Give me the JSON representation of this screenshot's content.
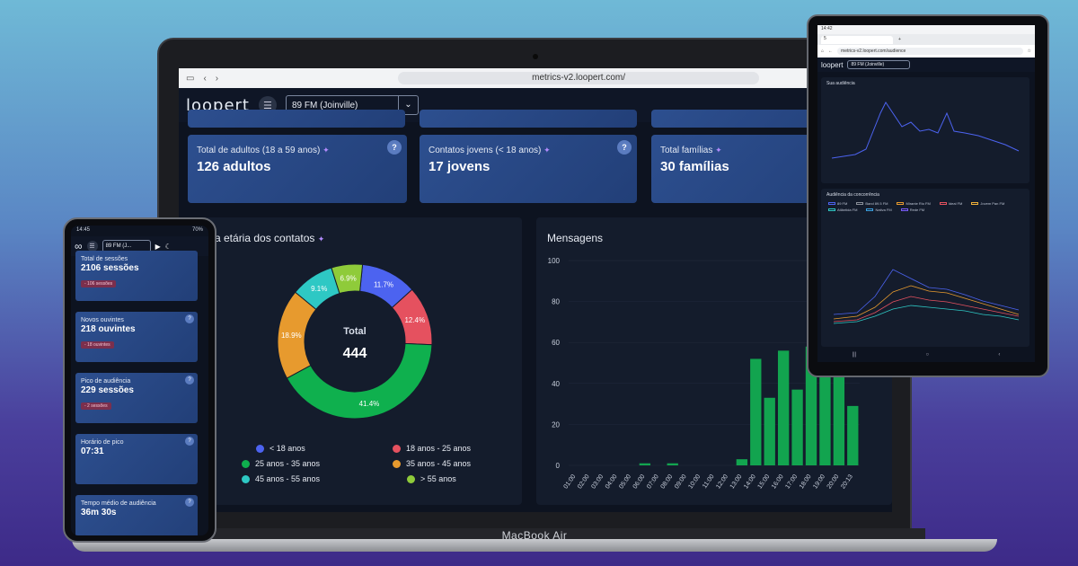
{
  "browser": {
    "url": "metrics-v2.loopert.com/"
  },
  "app": {
    "logo": "loopert",
    "station": "89 FM (Joinville)"
  },
  "cards": [
    {
      "label": "Total de adultos (18 a 59 anos)",
      "value": "126 adultos"
    },
    {
      "label": "Contatos jovens (< 18 anos)",
      "value": "17 jovens"
    },
    {
      "label": "Total famílias",
      "value": "30 famílias"
    }
  ],
  "age_panel": {
    "title": "a etária dos contatos",
    "total_label": "Total",
    "total_value": "444"
  },
  "messages_panel": {
    "title": "Mensagens"
  },
  "device": {
    "label": "MacBook Air"
  },
  "icons": {
    "sparkle": "✦",
    "help": "?",
    "volume": "🔈",
    "menu": "☰",
    "chevron": "⌄"
  },
  "chart_data": [
    {
      "type": "pie",
      "title": "",
      "categories": [
        "< 18 anos",
        "18 anos - 25 anos",
        "25 anos - 35 anos",
        "35 anos - 45 anos",
        "45 anos - 55 anos",
        "> 55 anos"
      ],
      "values": [
        11.7,
        12.4,
        41.4,
        18.9,
        9.1,
        6.5
      ],
      "labels": [
        "11.7%",
        "12.4%",
        "41.4%",
        "18.9%",
        "9.1%",
        "6.9%"
      ],
      "colors": [
        "#4c63f0",
        "#e5515f",
        "#0fb04e",
        "#e79a2e",
        "#2ec8c4",
        "#8fcb3a"
      ]
    },
    {
      "type": "bar",
      "title": "Mensagens",
      "categories": [
        "01:00",
        "02:00",
        "03:00",
        "04:00",
        "05:00",
        "06:00",
        "07:00",
        "08:00",
        "09:00",
        "10:00",
        "11:00",
        "12:00",
        "13:00",
        "14:00",
        "15:00",
        "16:00",
        "17:00",
        "18:00",
        "19:00",
        "20:00",
        "20:13"
      ],
      "values": [
        0,
        0,
        0,
        0,
        0,
        1,
        0,
        1,
        0,
        0,
        0,
        0,
        3,
        52,
        33,
        56,
        37,
        58,
        43,
        52,
        29
      ],
      "ylim": [
        0,
        100
      ],
      "yticks": [
        0,
        20,
        40,
        60,
        80,
        100
      ],
      "color": "#12a44f"
    }
  ],
  "phone": {
    "time": "14:45",
    "battery": "70%",
    "station": "89 FM (J...",
    "cards": [
      {
        "label": "Total de sessões",
        "value": "2106 sessões",
        "chip": "- 106 sessões"
      },
      {
        "label": "Novos ouvintes",
        "value": "218 ouvintes",
        "chip": "- 18 ouvintes"
      },
      {
        "label": "Pico de audiência",
        "value": "229 sessões",
        "chip": "- 2 sessões"
      },
      {
        "label": "Horário de pico",
        "value": "07:31",
        "chip": ""
      },
      {
        "label": "Tempo médio de audiência",
        "value": "36m 30s",
        "chip": ""
      }
    ]
  },
  "tablet": {
    "time": "14:42",
    "url": "metrics-v2.loopert.com/audience",
    "station": "89 FM (Joinville)",
    "panel1_title": "Sua audiência",
    "panel2_title": "Audiência da concorrência",
    "legend": [
      "89 FM",
      "Band 89.5 FM",
      "Mirante Rio FM",
      "Ideal FM",
      "Jovem Pan FM",
      "Atlântida FM",
      "Nativa FM",
      "Rede FM"
    ]
  }
}
